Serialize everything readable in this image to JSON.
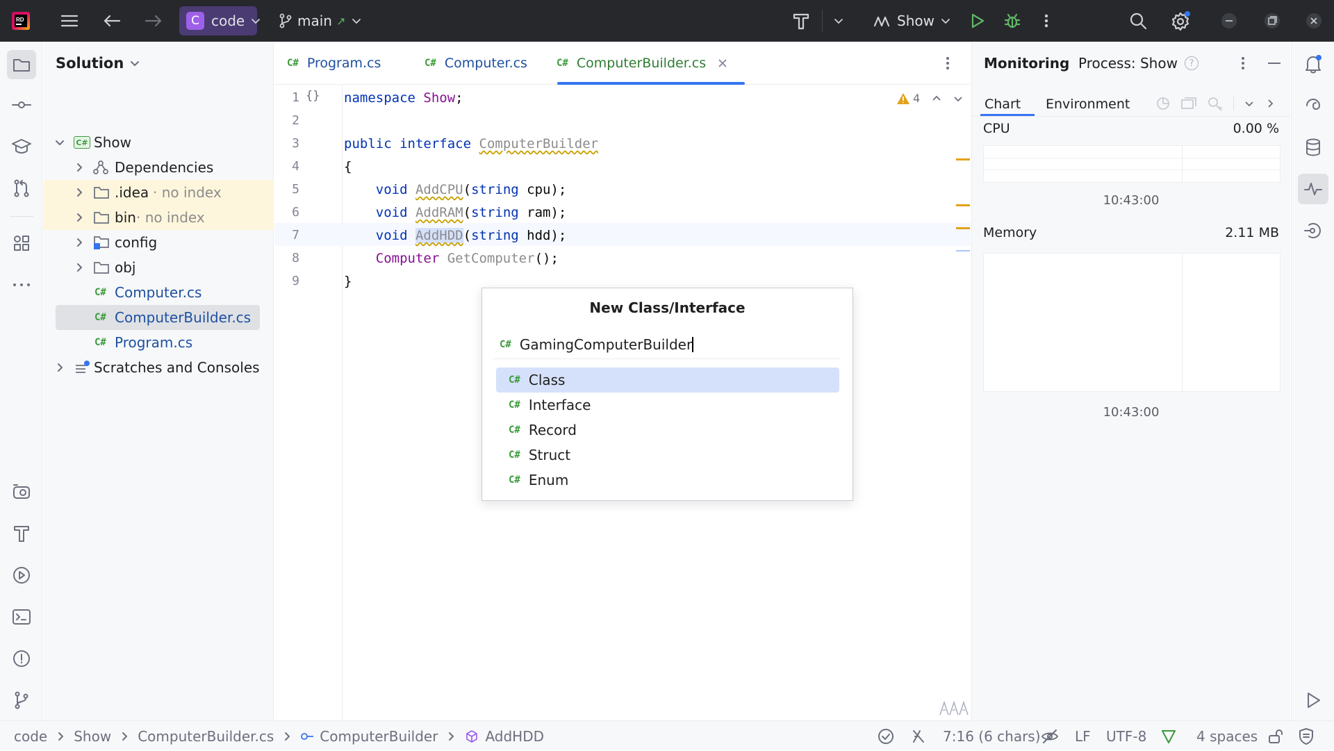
{
  "titlebar": {
    "project_badge": "C",
    "project_name": "code",
    "branch": "main",
    "branch_arrow": "↗",
    "run_config": "Show"
  },
  "project_panel": {
    "title": "Solution",
    "tree": [
      {
        "label": "Show",
        "suffix": "",
        "kind": "project"
      },
      {
        "label": "Dependencies",
        "suffix": "",
        "kind": "deps"
      },
      {
        "label": ".idea",
        "suffix": " · no index",
        "kind": "folder"
      },
      {
        "label": "bin",
        "suffix": " · no index",
        "kind": "folder"
      },
      {
        "label": "config",
        "suffix": "",
        "kind": "folder"
      },
      {
        "label": "obj",
        "suffix": "",
        "kind": "folder"
      },
      {
        "label": "Computer.cs",
        "suffix": "",
        "kind": "file"
      },
      {
        "label": "ComputerBuilder.cs",
        "suffix": "",
        "kind": "file"
      },
      {
        "label": "Program.cs",
        "suffix": "",
        "kind": "file"
      },
      {
        "label": "Scratches and Consoles",
        "suffix": "",
        "kind": "scratch"
      }
    ],
    "cs_badge": "C#"
  },
  "editor": {
    "tabs": [
      {
        "label": "Program.cs",
        "active": false
      },
      {
        "label": "Computer.cs",
        "active": false
      },
      {
        "label": "ComputerBuilder.cs",
        "active": true
      }
    ],
    "warnings_count": "4",
    "line_numbers": [
      "1",
      "2",
      "3",
      "4",
      "5",
      "6",
      "7",
      "8",
      "9"
    ],
    "braces_glyph": "{}",
    "lines": {
      "l1_kw": "namespace",
      "l1_name": "Show",
      "l1_end": ";",
      "l3_kw1": "public",
      "l3_kw2": "interface",
      "l3_name": "ComputerBuilder",
      "l4": "{",
      "l5_kw": "void",
      "l5_name": "AddCPU",
      "l5_open": "(",
      "l5_type": "string",
      "l5_rest": " cpu);",
      "l6_kw": "void",
      "l6_name": "AddRAM",
      "l6_open": "(",
      "l6_type": "string",
      "l6_rest": " ram);",
      "l7_kw": "void",
      "l7_name": "AddHDD",
      "l7_open": "(",
      "l7_type": "string",
      "l7_rest": " hdd);",
      "l8_type": "Computer",
      "l8_name": "GetComputer",
      "l8_rest": "();",
      "l9": "}"
    }
  },
  "dialog": {
    "title": "New Class/Interface",
    "input_value": "GamingComputerBuilder",
    "options": [
      {
        "label": "Class",
        "selected": true
      },
      {
        "label": "Interface",
        "selected": false
      },
      {
        "label": "Record",
        "selected": false
      },
      {
        "label": "Struct",
        "selected": false
      },
      {
        "label": "Enum",
        "selected": false
      }
    ]
  },
  "monitoring": {
    "title": "Monitoring",
    "process_label": "Process: Show",
    "help_glyph": "?",
    "tabs": [
      "Chart",
      "Environment"
    ],
    "cpu_label": "CPU",
    "cpu_value": "0.00 %",
    "cpu_time": "10:43:00",
    "memory_label": "Memory",
    "memory_value": "2.11 MB",
    "memory_time": "10:43:00"
  },
  "statusbar": {
    "breadcrumb": [
      "code",
      "Show",
      "ComputerBuilder.cs",
      "ComputerBuilder",
      "AddHDD"
    ],
    "position": "7:16 (6 chars)",
    "line_ending": "LF",
    "encoding": "UTF-8",
    "indent": "4 spaces"
  },
  "colors": {
    "accent": "#3574f0",
    "tab_active_text": "#2e7d32",
    "file_text": "#1e50a0",
    "ignored_bg": "#fdf6dc",
    "selection": "#d5e1fb",
    "warning": "#e3a21a"
  }
}
